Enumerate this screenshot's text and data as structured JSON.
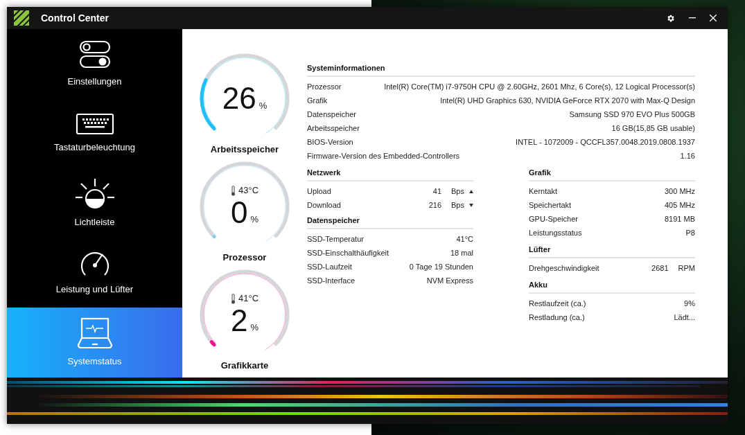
{
  "window": {
    "title": "Control Center"
  },
  "sidebar": {
    "items": [
      {
        "kind": "toggles",
        "label": "Einstellungen",
        "selected": false
      },
      {
        "kind": "keyboard",
        "label": "Tastaturbeleuchtung",
        "selected": false
      },
      {
        "kind": "light",
        "label": "Lichtleiste",
        "selected": false
      },
      {
        "kind": "gauge",
        "label": "Leistung und Lüfter",
        "selected": false
      },
      {
        "kind": "laptop",
        "label": "Systemstatus",
        "selected": true
      }
    ]
  },
  "gauges": [
    {
      "value": "26",
      "unit": "%",
      "label": "Arbeitsspeicher",
      "level": 0.26,
      "color": "#1ec0f5"
    },
    {
      "temperature": "43°C",
      "value": "0",
      "unit": "%",
      "label": "Prozessor",
      "level": 0,
      "color": "#7fc8f0"
    },
    {
      "temperature": "41°C",
      "value": "2",
      "unit": "%",
      "label": "Grafikkarte",
      "level": 0.02,
      "color": "#f0148c"
    }
  ],
  "system_info": {
    "title": "Systeminformationen",
    "rows": [
      {
        "label": "Prozessor",
        "value": "Intel(R) Core(TM) i7-9750H CPU @ 2.60GHz, 2601 Mhz, 6 Core(s), 12 Logical Processor(s)"
      },
      {
        "label": "Grafik",
        "value": "Intel(R) UHD Graphics 630, NVIDIA GeForce RTX 2070 with Max-Q Design"
      },
      {
        "label": "Datenspeicher",
        "value": "Samsung SSD 970 EVO Plus 500GB"
      },
      {
        "label": "Arbeitsspeicher",
        "value": "16 GB(15,85 GB usable)"
      },
      {
        "label": "BIOS-Version",
        "value": "INTEL  - 1072009 - QCCFL357.0048.2019.0808.1937"
      },
      {
        "label": "Firmware-Version des Embedded-Controllers",
        "value": "1.16"
      }
    ]
  },
  "network": {
    "title": "Netzwerk",
    "rows": [
      {
        "label": "Upload",
        "value": "41",
        "unit": "Bps",
        "kind": "up"
      },
      {
        "label": "Download",
        "value": "216",
        "unit": "Bps",
        "kind": "down"
      }
    ]
  },
  "storage": {
    "title": "Datenspeicher",
    "rows": [
      {
        "label": "SSD-Temperatur",
        "value": "41°C"
      },
      {
        "label": "SSD-Einschalthäufigkeit",
        "value": "18 mal"
      },
      {
        "label": "SSD-Laufzeit",
        "value": "0 Tage 19 Stunden"
      },
      {
        "label": "SSD-Interface",
        "value": "NVM Express"
      }
    ]
  },
  "graphics": {
    "title": "Grafik",
    "rows": [
      {
        "label": "Kerntakt",
        "value": "300 MHz"
      },
      {
        "label": "Speichertakt",
        "value": "405 MHz"
      },
      {
        "label": "GPU-Speicher",
        "value": "8191 MB"
      },
      {
        "label": "Leistungsstatus",
        "value": "P8"
      }
    ]
  },
  "fan": {
    "title": "Lüfter",
    "rows": [
      {
        "label": "Drehgeschwindigkeit",
        "value": "2681",
        "unit": "RPM"
      }
    ]
  },
  "battery": {
    "title": "Akku",
    "rows": [
      {
        "label": "Restlaufzeit (ca.)",
        "value": "9%"
      },
      {
        "label": "Restladung (ca.)",
        "value": "Lädt..."
      }
    ]
  }
}
